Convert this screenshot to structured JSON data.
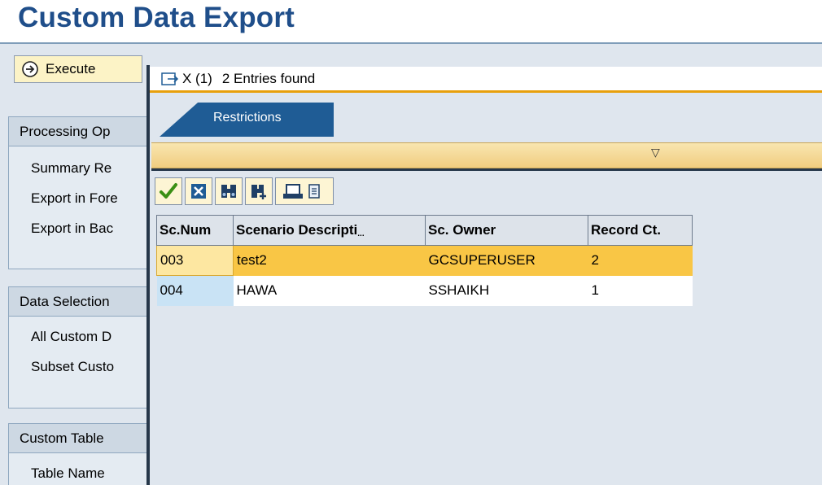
{
  "page": {
    "title": "Custom Data Export"
  },
  "toolbar": {
    "execute_label": "Execute"
  },
  "groups": [
    {
      "header": "Processing Op",
      "items": [
        "Summary Re",
        "Export in Fore",
        "Export in Bac"
      ]
    },
    {
      "header": "Data Selection",
      "items": [
        "All Custom D",
        "Subset Custo"
      ]
    },
    {
      "header": "Custom Table",
      "items": [
        "Table Name"
      ]
    }
  ],
  "popup": {
    "x_count": "X (1)",
    "entries_text": "2 Entries found",
    "tab_label": "Restrictions",
    "collapse_arrow": "▽"
  },
  "grid": {
    "headers": [
      "Sc.Num",
      "Scenario Descripti",
      "Sc. Owner",
      "Record Ct."
    ],
    "header_overflow": "...",
    "rows": [
      [
        "003",
        "test2",
        "GCSUPERUSER",
        "2"
      ],
      [
        "004",
        "HAWA",
        "SSHAIKH",
        "1"
      ]
    ]
  },
  "colors": {
    "title": "#1f4e8a",
    "accent": "#e8a00c",
    "selected_row": "#f9c645",
    "tab": "#1f5c95"
  }
}
